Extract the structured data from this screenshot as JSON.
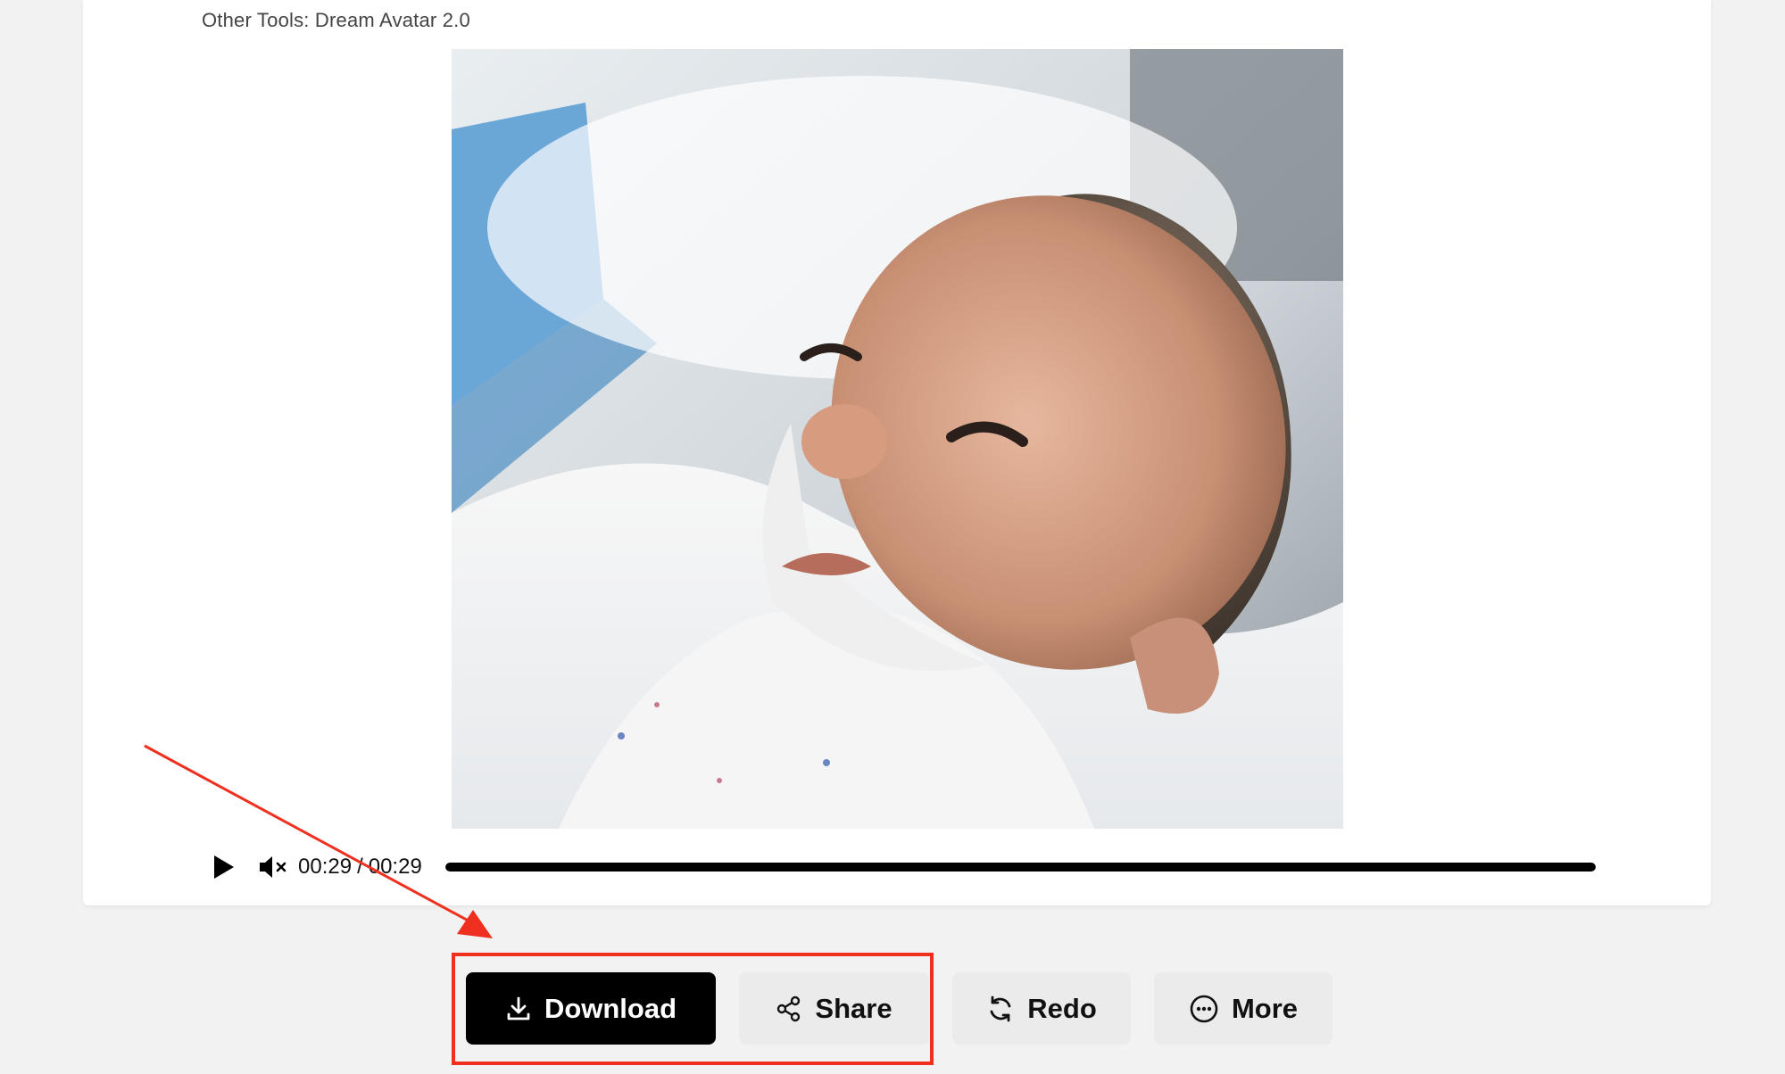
{
  "header": {
    "other_tools": "Other Tools: Dream Avatar 2.0"
  },
  "video": {
    "current_time": "00:29",
    "separator": "/",
    "duration": "00:29",
    "progress_percent": 100,
    "muted": true
  },
  "actions": {
    "download": "Download",
    "share": "Share",
    "redo": "Redo",
    "more": "More"
  },
  "colors": {
    "annotation": "#f0301f",
    "primary_button": "#000000",
    "secondary_button": "#ebebeb"
  }
}
